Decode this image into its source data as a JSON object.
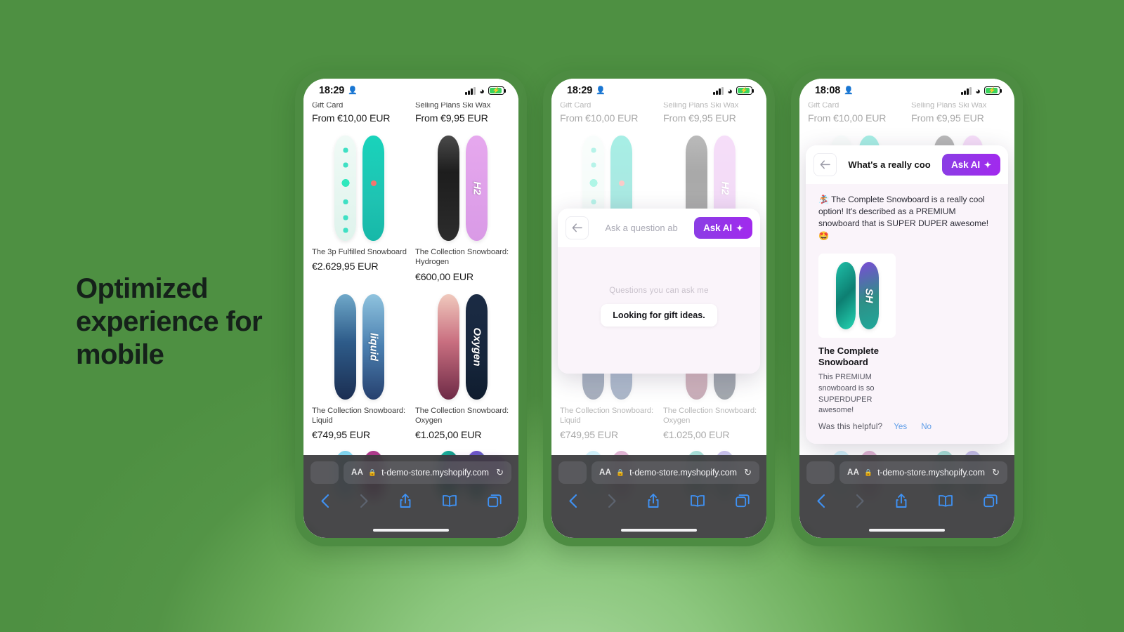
{
  "headline": "Optimized experience for  mobile",
  "colors": {
    "background_green": "#519244",
    "phone_frame_green": "#4d8c42",
    "accent_purple_from": "#8a3ee4",
    "accent_purple_to": "#a229ee",
    "safari_blue": "#3f92f5",
    "modal_body_pink": "#faf4fa",
    "battery_green": "#3ad45e"
  },
  "status_bars": [
    {
      "time": "18:29",
      "person_icon": "person-icon",
      "signal_icon": "cellular-signal-icon",
      "wifi_icon": "wifi-icon",
      "battery_icon": "battery-charging-icon",
      "bolt": "⚡"
    },
    {
      "time": "18:29",
      "person_icon": "person-icon",
      "signal_icon": "cellular-signal-icon",
      "wifi_icon": "wifi-icon",
      "battery_icon": "battery-charging-icon",
      "bolt": "⚡"
    },
    {
      "time": "18:08",
      "person_icon": "person-icon",
      "signal_icon": "cellular-signal-icon",
      "wifi_icon": "wifi-icon",
      "battery_icon": "battery-charging-icon",
      "bolt": "⚡"
    }
  ],
  "store": {
    "row_clipped": [
      {
        "name": "Gift Card",
        "price": "From €10,00 EUR"
      },
      {
        "name": "Selling Plans Ski Wax",
        "price": "From €9,95 EUR"
      }
    ],
    "row_1": [
      {
        "name": "The 3p Fulfilled Snowboard",
        "price": "€2.629,95 EUR"
      },
      {
        "name": "The Collection Snowboard: Hydrogen",
        "price": "€600,00 EUR"
      }
    ],
    "row_2": [
      {
        "name": "The Collection Snowboard: Liquid",
        "price": "€749,95 EUR"
      },
      {
        "name": "The Collection Snowboard: Oxygen",
        "price": "€1.025,00 EUR"
      }
    ]
  },
  "ask_ai_fab": {
    "label": "Ask AI",
    "sparkle_icon": "sparkle-icon"
  },
  "modal_2": {
    "back_icon": "back-arrow-icon",
    "query_placeholder": "Ask a question ab",
    "ask_label": "Ask AI",
    "sparkle_icon": "sparkle-icon",
    "suggest_label": "Questions you can ask me",
    "suggest_chip": "Looking for gift ideas."
  },
  "modal_3": {
    "back_icon": "back-arrow-icon",
    "query": "What's a really coo",
    "ask_label": "Ask AI",
    "sparkle_icon": "sparkle-icon",
    "answer": "🏂 The Complete Snowboard is a really cool option! It's described as a PREMIUM snowboard that is SUPER DUPER awesome! 🤩",
    "product_title": "The Complete Snowboard",
    "product_desc": "This PREMIUM snowboard is so SUPERDUPER awesome!",
    "helpful_question": "Was this helpful?",
    "helpful_yes": "Yes",
    "helpful_no": "No"
  },
  "safari": {
    "aa_label": "AA",
    "lock_icon": "lock-icon",
    "url": "t-demo-store.myshopify.com",
    "reload_icon": "reload-icon",
    "back_icon": "back-chevron-icon",
    "forward_icon": "forward-chevron-icon",
    "share_icon": "share-icon",
    "bookmarks_icon": "bookmarks-icon",
    "tabs_icon": "tabs-icon"
  }
}
